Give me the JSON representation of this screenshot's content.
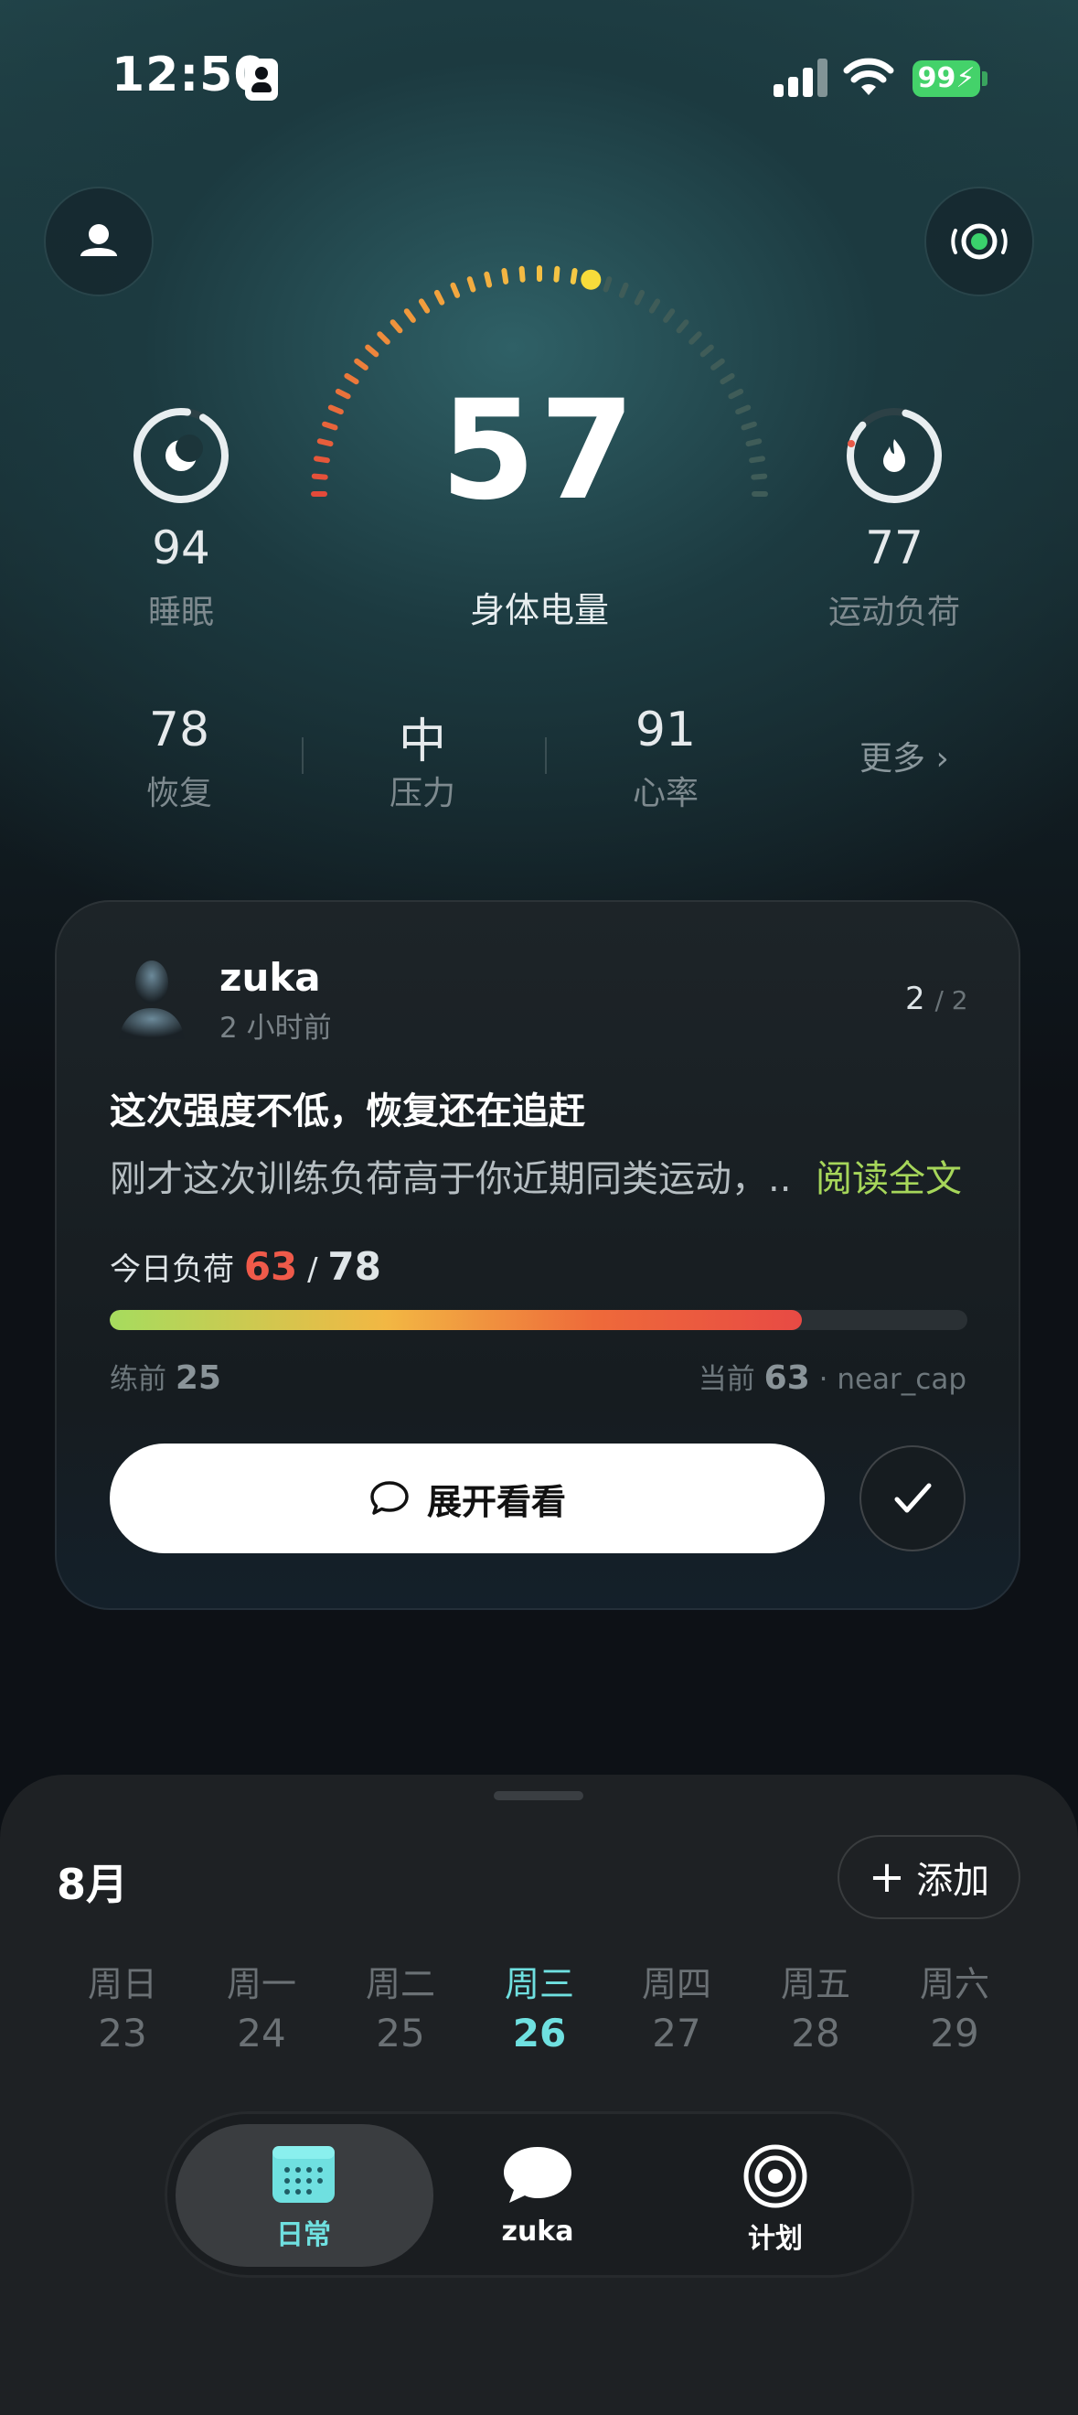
{
  "status": {
    "time": "12:50",
    "battery": "99"
  },
  "gauge": {
    "value": "57",
    "label": "身体电量"
  },
  "metrics": {
    "sleep": {
      "value": "94",
      "label": "睡眠"
    },
    "load": {
      "value": "77",
      "label": "运动负荷"
    }
  },
  "stats": [
    {
      "value": "78",
      "label": "恢复"
    },
    {
      "value": "中",
      "label": "压力"
    },
    {
      "value": "91",
      "label": "心率"
    }
  ],
  "more_label": "更多",
  "card": {
    "user": "zuka",
    "time": "2 小时前",
    "page_current": "2",
    "page_total": "/ 2",
    "title": "这次强度不低，恢复还在追赶",
    "body": "刚才这次训练负荷高于你近期同类运动，..",
    "read_more": "阅读全文",
    "load_label": "今日负荷",
    "load_current": "63",
    "load_sep": "/",
    "load_total": "78",
    "load_fraction": 0.807,
    "pre_label": "练前",
    "pre_value": "25",
    "now_label": "当前",
    "now_value": "63",
    "now_status": "· near_cap",
    "expand_label": "展开看看"
  },
  "calendar": {
    "month": "8月",
    "add_label": "添加",
    "days": [
      {
        "weekday": "周日",
        "date": "23"
      },
      {
        "weekday": "周一",
        "date": "24"
      },
      {
        "weekday": "周二",
        "date": "25"
      },
      {
        "weekday": "周三",
        "date": "26"
      },
      {
        "weekday": "周四",
        "date": "27"
      },
      {
        "weekday": "周五",
        "date": "28"
      },
      {
        "weekday": "周六",
        "date": "29"
      }
    ]
  },
  "tabs": [
    {
      "label": "日常",
      "icon": "calendar-icon"
    },
    {
      "label": "zuka",
      "icon": "chat-bubble-icon"
    },
    {
      "label": "计划",
      "icon": "target-icon"
    }
  ],
  "colors": {
    "accent": "#6fe0e0",
    "load_red": "#ef5a4a",
    "link_green": "#a6d65a"
  }
}
